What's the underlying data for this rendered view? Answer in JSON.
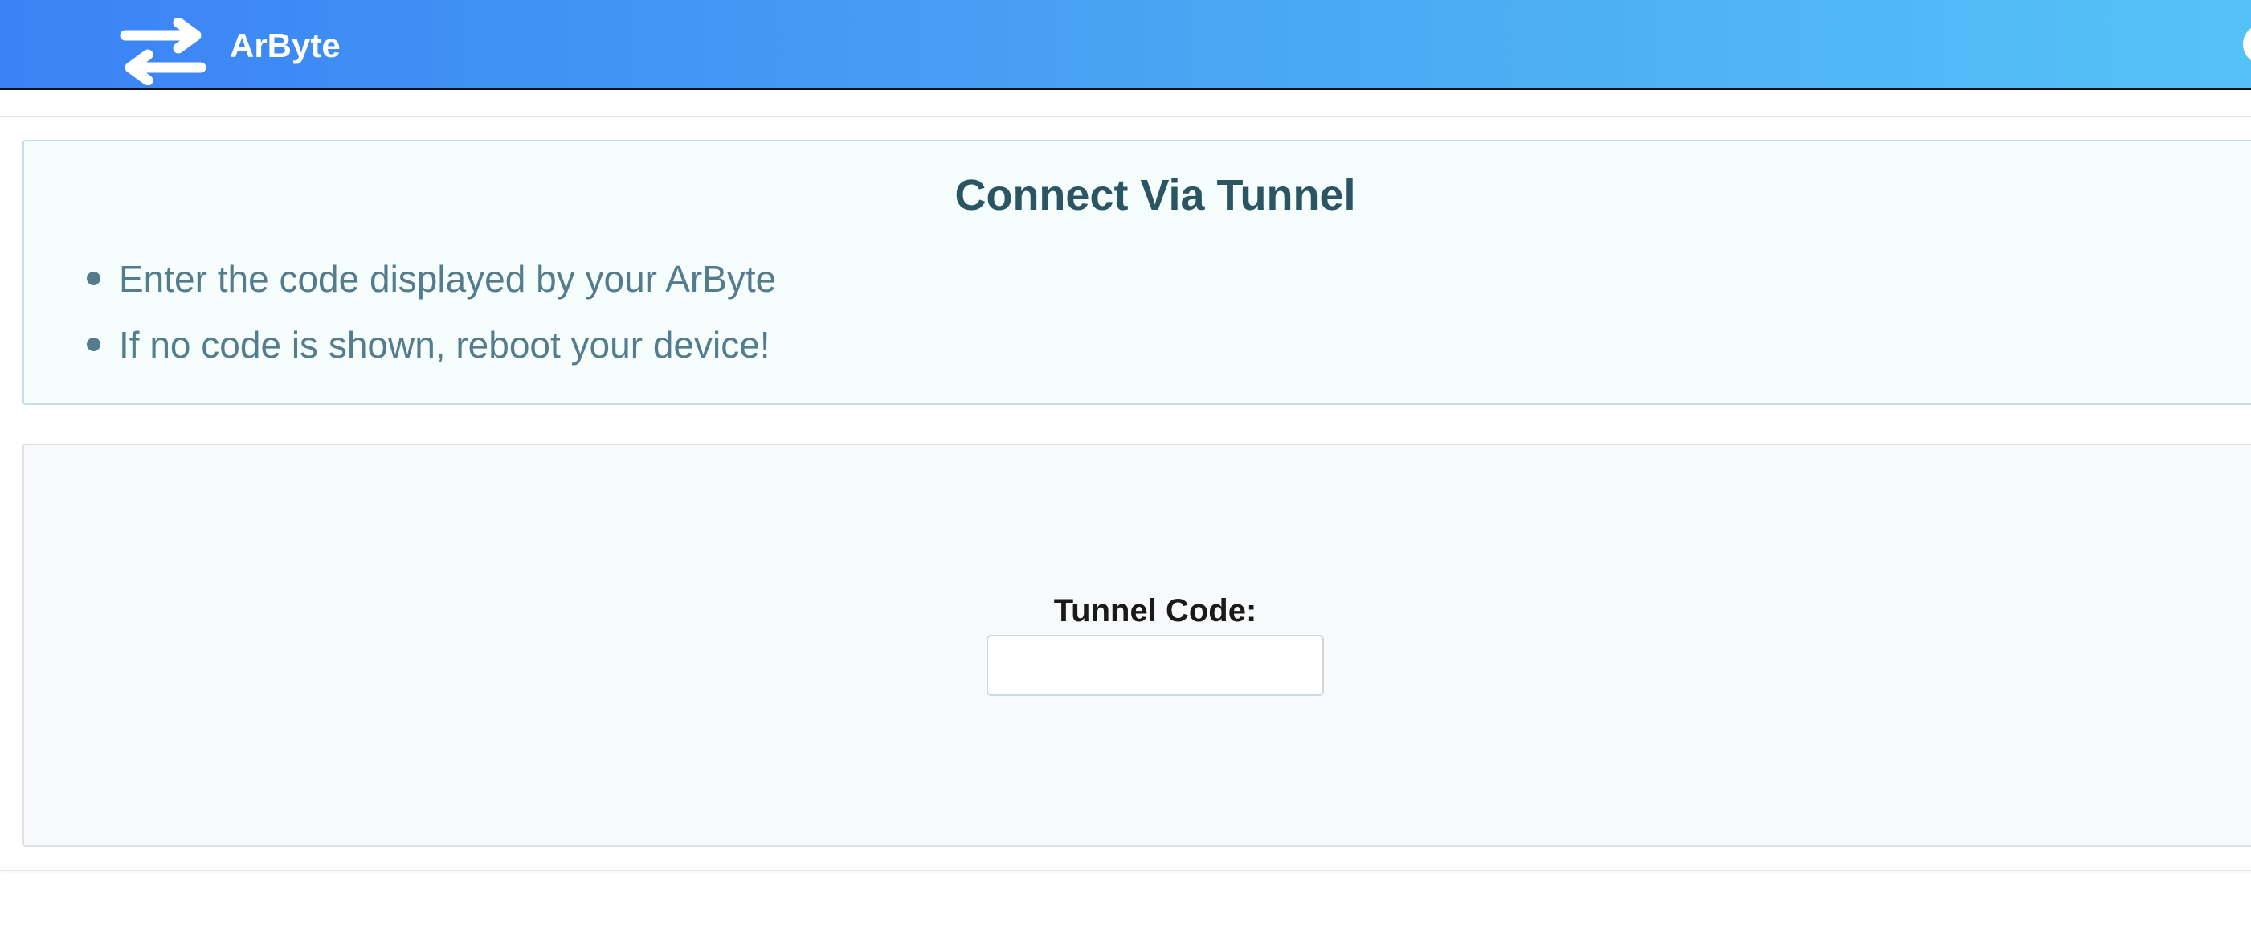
{
  "navbar": {
    "brand_name": "ArByte",
    "brand_icon": "arrows-left-right-icon",
    "colors": {
      "gradient_start": "#3b82f6",
      "gradient_end": "#55c2f7",
      "text": "#ffffff"
    }
  },
  "info": {
    "title": "Connect Via Tunnel",
    "items": [
      "Enter the code displayed by your ArByte",
      "If no code is shown, reboot your device!"
    ],
    "colors": {
      "title": "#2b5563",
      "text": "#557c8c",
      "background": "#f5fdfd",
      "border": "#bfdfe3"
    }
  },
  "form": {
    "label": "Tunnel Code:",
    "input_value": "",
    "input_placeholder": ""
  }
}
